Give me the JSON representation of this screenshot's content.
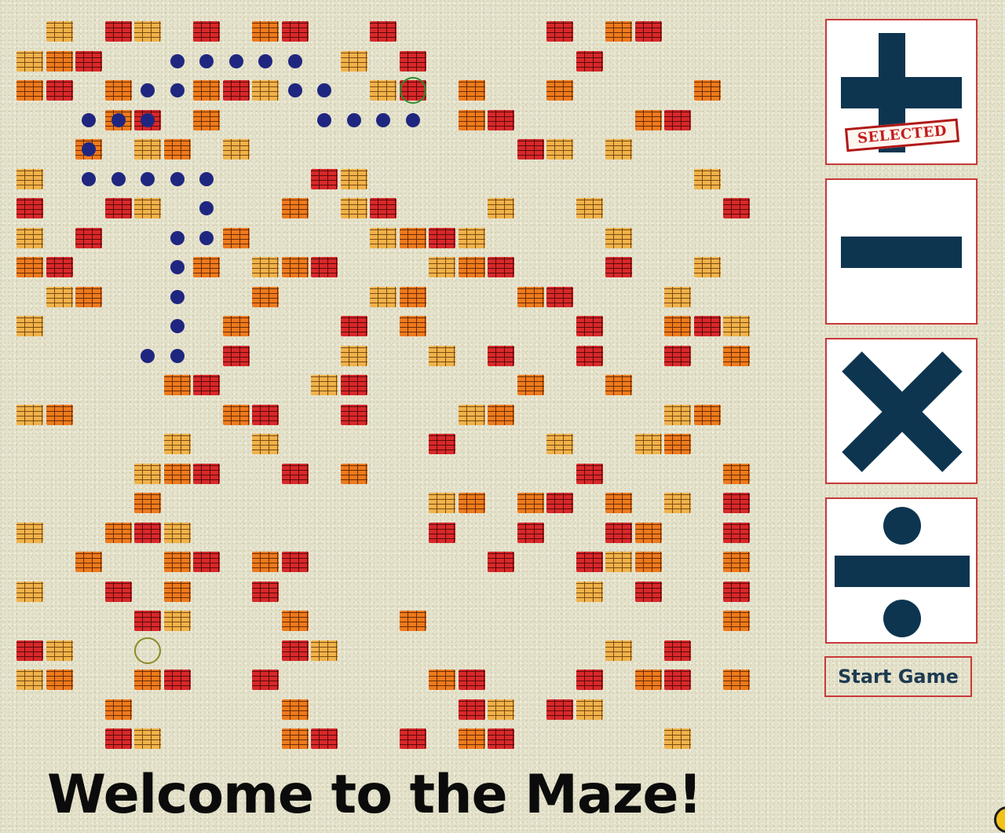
{
  "title": "Welcome to the Maze!",
  "operators": [
    {
      "name": "plus",
      "icon": "plus-icon",
      "selected": true,
      "badge": "SELECTED"
    },
    {
      "name": "minus",
      "icon": "minus-icon",
      "selected": false
    },
    {
      "name": "times",
      "icon": "times-icon",
      "selected": false
    },
    {
      "name": "divide",
      "icon": "divide-icon",
      "selected": false
    }
  ],
  "start_button": "Start Game",
  "colors": {
    "background": "#e5e2cb",
    "brick_tan": "#f0b24a",
    "brick_orange": "#ee7a1c",
    "brick_red": "#d8282a",
    "path_dot": "#1f2680",
    "operator_icon": "#0d3550",
    "button_border": "#c83a3a"
  },
  "maze": {
    "rows": 25,
    "cols": 25,
    "brick_rows": [
      "_t_rt_r_or__r_____r_or___",
      "tors.....__t_r_____r_____",
      "or_o..ort.._tr_o__o____o_",
      "...or_o_....___or____or__",
      "._o_to_t_________rt_t____",
      "t.....____rt___________t_",
      "r__rt_.__o_tr___t__t____r",
      "t_r__..o____tort____t____",
      "or___.o_tor___tor___r__t_",
      "_to__.__o___to___or___t__",
      "t_____.o___r_o_____r__ort",
      "_____..r___t__t_r__r__r_o",
      "_____or___tr_____o__o____",
      "to_____or__r___to_____to_t",
      "_____t__t_____r___t__to__",
      "____tor__r_o_______r____o",
      "____o_________to_or_o_t_r",
      "t__ort________r__r__ro__r",
      "__o__or_or______r__rto__o",
      "t__r_o__r__________t_r__r",
      "____rt___o___o__________o",
      "rt_______rt_________t_r__",
      "to__or__r_____or___r_or_ort",
      "___o_____o_____rt_rt_____",
      "___rt____or__r_or_____t__or"
    ],
    "path_cells": [
      [
        1,
        5
      ],
      [
        1,
        6
      ],
      [
        1,
        7
      ],
      [
        1,
        8
      ],
      [
        1,
        9
      ],
      [
        2,
        4
      ],
      [
        2,
        5
      ],
      [
        2,
        9
      ],
      [
        2,
        10
      ],
      [
        3,
        2
      ],
      [
        3,
        3
      ],
      [
        3,
        4
      ],
      [
        3,
        10
      ],
      [
        3,
        11
      ],
      [
        3,
        12
      ],
      [
        3,
        13
      ],
      [
        4,
        2
      ],
      [
        5,
        2
      ],
      [
        5,
        3
      ],
      [
        5,
        4
      ],
      [
        5,
        5
      ],
      [
        5,
        6
      ],
      [
        6,
        6
      ],
      [
        7,
        5
      ],
      [
        7,
        6
      ],
      [
        8,
        5
      ],
      [
        9,
        5
      ],
      [
        10,
        5
      ],
      [
        11,
        4
      ],
      [
        11,
        5
      ]
    ],
    "goal": {
      "row": 2,
      "col": 13
    },
    "player": {
      "row": 21,
      "col": 4
    }
  }
}
